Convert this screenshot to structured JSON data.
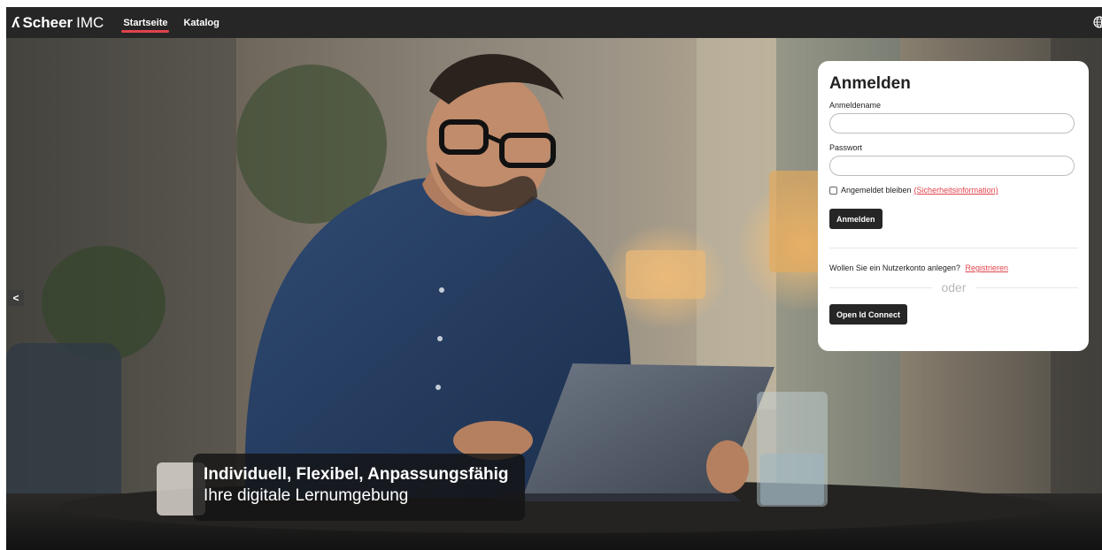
{
  "brand": {
    "mark": "ʎ",
    "name": "Scheer",
    "suffix": "IMC"
  },
  "nav": {
    "items": [
      {
        "label": "Startseite",
        "active": true
      },
      {
        "label": "Katalog",
        "active": false
      }
    ]
  },
  "hero": {
    "caption_title": "Individuell, Flexibel, Anpassungsfähig",
    "caption_subtitle": "Ihre digitale Lernumgebung",
    "prev_glyph": "<"
  },
  "login": {
    "title": "Anmelden",
    "username_label": "Anmeldename",
    "username_value": "",
    "password_label": "Passwort",
    "password_value": "",
    "remember_label": "Angemeldet bleiben",
    "security_link": "(Sicherheitsinformation)",
    "submit_label": "Anmelden",
    "register_prompt": "Wollen Sie ein Nutzerkonto anlegen?",
    "register_link": "Registrieren",
    "or_text": "oder",
    "oidc_label": "Open Id Connect"
  },
  "colors": {
    "topbar": "#262626",
    "accent": "#e0434b",
    "button": "#262626"
  },
  "icons": {
    "language": "globe-icon",
    "previous": "chevron-left-icon"
  }
}
